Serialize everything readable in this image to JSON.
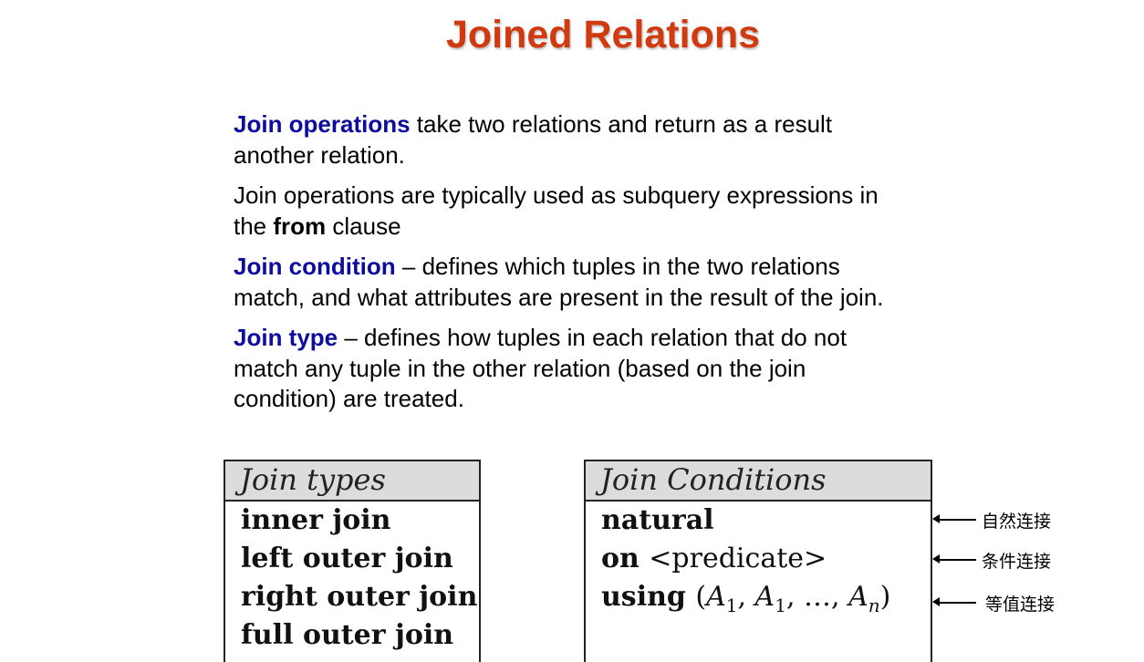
{
  "title": "Joined Relations",
  "colors": {
    "title": "#d03a0e",
    "keyword": "#0c0c9e"
  },
  "paragraphs": {
    "p1": {
      "kw": "Join operations",
      "rest": " take two relations and return as a result another relation."
    },
    "p2": {
      "pre": "Join operations are typically used as subquery expressions in the ",
      "bold": "from",
      "post": " clause"
    },
    "p3": {
      "kw": "Join condition",
      "rest": " – defines which tuples in the two relations match, and what attributes are present in the result of the join."
    },
    "p4": {
      "kw": "Join type",
      "rest": " – defines how tuples in each relation that do not match any tuple in the other relation (based on the join condition) are treated."
    }
  },
  "join_types": {
    "header": "Join types",
    "rows": [
      "inner join",
      "left outer join",
      "right outer join",
      "full outer join"
    ]
  },
  "join_conditions": {
    "header": "Join Conditions",
    "natural": "natural",
    "on_kw": "on",
    "on_arg": "<predicate>",
    "using_kw": "using",
    "using_open": "(",
    "a": "A",
    "sub1": "1",
    "sep": ", ",
    "ellipsis": "…",
    "subn": "n",
    "using_close": ")"
  },
  "annotations": [
    "自然连接",
    "条件连接",
    "等值连接"
  ]
}
